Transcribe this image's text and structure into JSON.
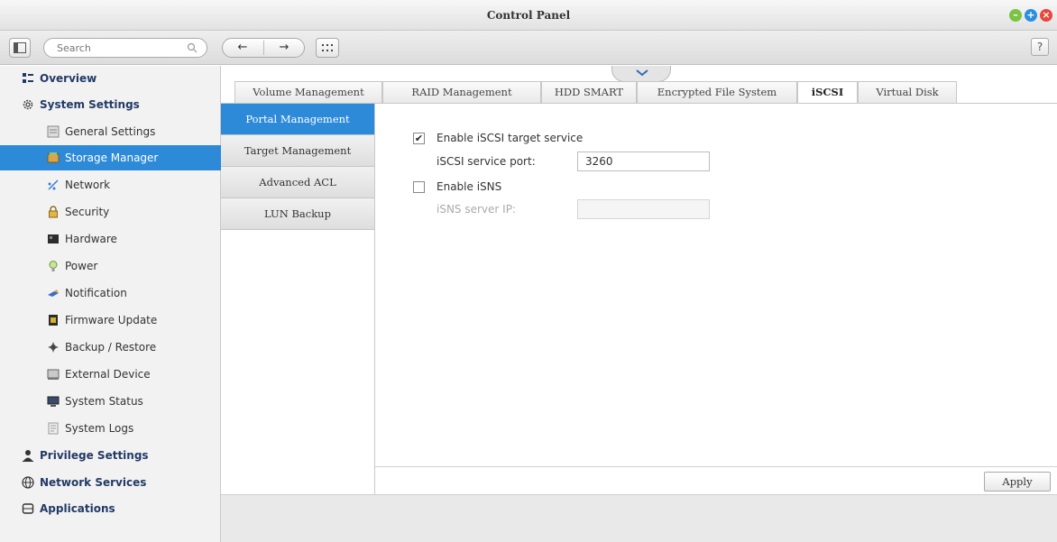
{
  "window": {
    "title": "Control Panel"
  },
  "toolbar": {
    "search_placeholder": "Search",
    "back_label": "←",
    "forward_label": "→",
    "help_label": "?"
  },
  "sidebar": {
    "items": [
      {
        "label": "Overview",
        "level": "top",
        "icon": "overview-icon"
      },
      {
        "label": "System Settings",
        "level": "top",
        "icon": "gear-icon"
      },
      {
        "label": "General Settings",
        "level": "sub",
        "icon": "general-settings-icon"
      },
      {
        "label": "Storage Manager",
        "level": "sub",
        "icon": "storage-icon",
        "active": true
      },
      {
        "label": "Network",
        "level": "sub",
        "icon": "network-icon"
      },
      {
        "label": "Security",
        "level": "sub",
        "icon": "lock-icon"
      },
      {
        "label": "Hardware",
        "level": "sub",
        "icon": "hardware-icon"
      },
      {
        "label": "Power",
        "level": "sub",
        "icon": "power-icon"
      },
      {
        "label": "Notification",
        "level": "sub",
        "icon": "notification-icon"
      },
      {
        "label": "Firmware Update",
        "level": "sub",
        "icon": "firmware-icon"
      },
      {
        "label": "Backup / Restore",
        "level": "sub",
        "icon": "backup-icon"
      },
      {
        "label": "External Device",
        "level": "sub",
        "icon": "external-device-icon"
      },
      {
        "label": "System Status",
        "level": "sub",
        "icon": "monitor-icon"
      },
      {
        "label": "System Logs",
        "level": "sub",
        "icon": "logs-icon"
      },
      {
        "label": "Privilege Settings",
        "level": "top",
        "icon": "user-icon"
      },
      {
        "label": "Network Services",
        "level": "top",
        "icon": "globe-icon"
      },
      {
        "label": "Applications",
        "level": "top",
        "icon": "applications-icon"
      }
    ]
  },
  "tabs": [
    {
      "label": "Volume Management"
    },
    {
      "label": "RAID Management"
    },
    {
      "label": "HDD SMART"
    },
    {
      "label": "Encrypted File System"
    },
    {
      "label": "iSCSI",
      "active": true
    },
    {
      "label": "Virtual Disk"
    }
  ],
  "subnav": [
    {
      "label": "Portal Management",
      "active": true
    },
    {
      "label": "Target Management"
    },
    {
      "label": "Advanced ACL"
    },
    {
      "label": "LUN Backup"
    }
  ],
  "form": {
    "enable_iscsi": {
      "label": "Enable iSCSI target service",
      "checked": true
    },
    "service_port": {
      "label": "iSCSI service port:",
      "value": "3260"
    },
    "enable_isns": {
      "label": "Enable iSNS",
      "checked": false
    },
    "isns_server_ip": {
      "label": "iSNS server IP:",
      "value": ""
    }
  },
  "footer": {
    "apply_label": "Apply"
  },
  "colors": {
    "accent": "#2d8ad8",
    "min": "#7cc243",
    "max": "#2b8fe0",
    "close": "#e8473c"
  }
}
